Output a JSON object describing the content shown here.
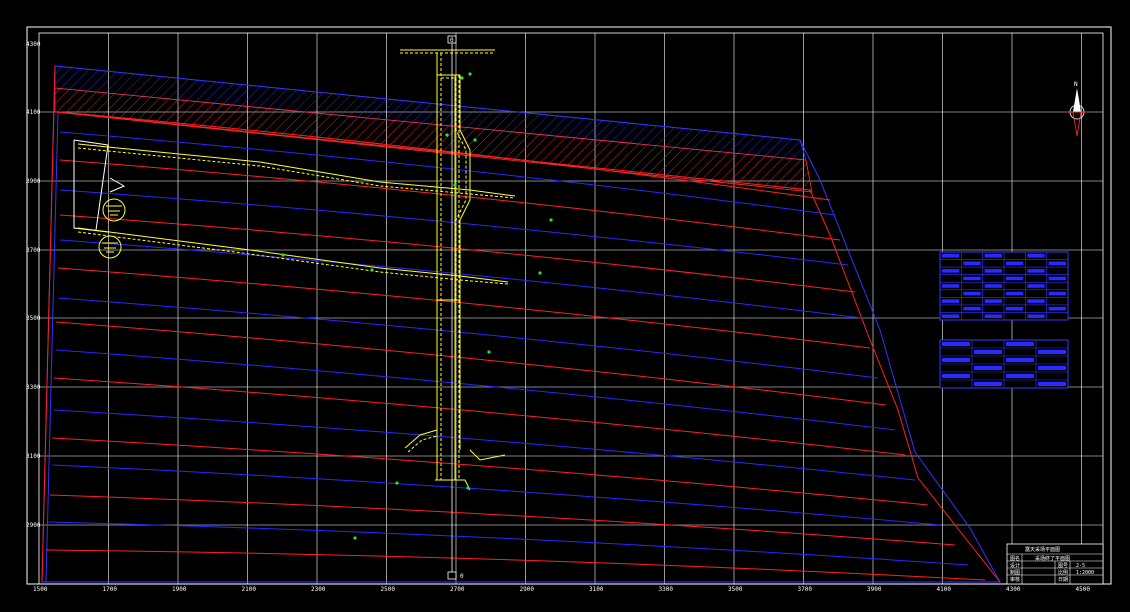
{
  "grid": {
    "x_labels": [
      "1500",
      "1700",
      "1900",
      "2100",
      "2300",
      "2500",
      "2700",
      "2900",
      "3100",
      "3300",
      "3500",
      "3700",
      "3900",
      "4100",
      "4300",
      "4500"
    ],
    "y_labels": [
      "4300",
      "4100",
      "3900",
      "3700",
      "3500",
      "3300",
      "3100",
      "2900"
    ]
  },
  "north": {
    "label": "N"
  },
  "axis_marks": {
    "top": "0",
    "bottom": "0"
  },
  "title_block": {
    "title": "露天采场平面图",
    "rows": [
      [
        "图名",
        "采场终了平面图",
        "",
        ""
      ],
      [
        "设计",
        "",
        "图号",
        "2-5"
      ],
      [
        "制图",
        "",
        "比例",
        "1:2000"
      ],
      [
        "审核",
        "",
        "日期",
        ""
      ]
    ]
  },
  "colors": {
    "grid": "#ffffff",
    "contour_red": "#ff2020",
    "contour_blue": "#2828ff",
    "hatch": "#ff3030",
    "road": "#ffff33",
    "marker": "#33dd33"
  }
}
